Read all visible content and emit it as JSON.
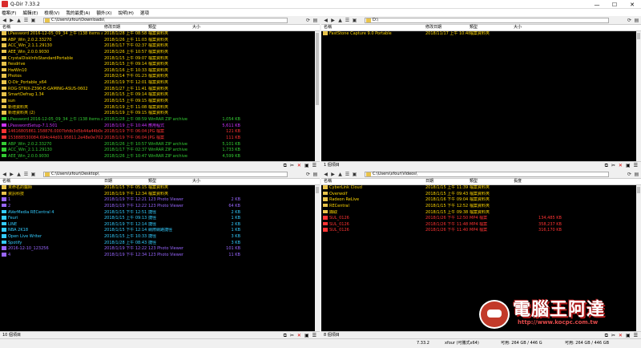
{
  "window": {
    "title": "Q-Dir 7.33.2",
    "min": "—",
    "max": "☐",
    "close": "✕"
  },
  "menu": [
    "檔案(F)",
    "編輯(E)",
    "檢視(V)",
    "我的最愛(A)",
    "額外(X)",
    "說明(H)",
    "選項"
  ],
  "colors": {
    "folder": "#ffd700",
    "exe": "#cc33ff",
    "zip": "#33cc33",
    "img": "#9966ff",
    "red": "#ff3333",
    "shortcut": "#33ccff"
  },
  "panes": [
    {
      "id": "tl",
      "path": "C:\\Users\\xfour\\Downloads\\",
      "status": "",
      "cols": [
        "名稱",
        "修改日期",
        "類型",
        "大小"
      ],
      "rows": [
        [
          "LPassword 2016-12-05_09_34 上午 (138 items and 1 fo...",
          "2018/1/28 上午 08:58",
          "檔案資料夾",
          "",
          "folder"
        ],
        [
          "ABP_Win_2.0.2.33270",
          "2018/1/26 上午 11:03",
          "檔案資料夾",
          "",
          "folder"
        ],
        [
          "ACC_Win_2.1.1.29130",
          "2018/1/17 下午 02:37",
          "檔案資料夾",
          "",
          "folder"
        ],
        [
          "AEE_Win_2.0.0.9030",
          "2018/1/26 上午 10:57",
          "檔案資料夾",
          "",
          "folder"
        ],
        [
          "CrystalDiskInfoStandardPortable",
          "2018/1/15 上午 09:07",
          "檔案資料夾",
          "",
          "folder"
        ],
        [
          "fiesdrive",
          "2018/1/15 上午 09:14",
          "檔案資料夾",
          "",
          "folder"
        ],
        [
          "HwWin10",
          "2018/1/16 上午 10:33",
          "檔案資料夾",
          "",
          "folder"
        ],
        [
          "Photos",
          "2018/2/14 下午 01:23",
          "檔案資料夾",
          "",
          "folder"
        ],
        [
          "Q-Dir_Portable_x64",
          "2018/1/19 下午 12:01",
          "檔案資料夾",
          "",
          "folder"
        ],
        [
          "ROG-STRIX-Z390-E-GAMING-ASUS-0602",
          "2018/1/27 上午 11:41",
          "檔案資料夾",
          "",
          "folder"
        ],
        [
          "SmartDefrag 1.34",
          "2018/1/15 上午 09:14",
          "檔案資料夾",
          "",
          "folder"
        ],
        [
          "sun",
          "2018/1/15 上午 09:15",
          "檔案資料夾",
          "",
          "folder"
        ],
        [
          "新增資料夾",
          "2018/1/19 上午 11:08",
          "檔案資料夾",
          "",
          "folder"
        ],
        [
          "新增資料夾 (2)",
          "2018/1/19 上午 09:15",
          "檔案資料夾",
          "",
          "folder"
        ],
        [
          "LPassword 2016-12-05_09_34 上午 (138 items and 1 fo...",
          "2018/1/28 上午 08:59",
          "WinRAR ZIP archive",
          "1,054 KB",
          "zip"
        ],
        [
          "LPasswordSetup-7.1.501",
          "2018/1/19 上午 10:44",
          "應用程式",
          "5,611 KB",
          "exe"
        ],
        [
          "14616805861.158876.0007bfdb3d5b44a44b0e3d47",
          "2018/1/19 下午 06:04",
          "JPG 檔案",
          "121 KB",
          "red"
        ],
        [
          "153888530084.694c44d01.95811.2e48e0e702fca39",
          "2018/1/19 下午 06:04",
          "JPG 檔案",
          "111 KB",
          "red"
        ],
        [
          "ABP_Win_2.0.2.33270",
          "2018/1/26 上午 10:57",
          "WinRAR ZIP archive",
          "5,101 KB",
          "zip"
        ],
        [
          "ACC_Win_2.1.1.29130",
          "2018/1/17 下午 02:37",
          "WinRAR ZIP archive",
          "1,733 KB",
          "zip"
        ],
        [
          "AEE_Win_2.0.0.9030",
          "2018/1/26 上午 10:47",
          "WinRAR ZIP archive",
          "4,599 KB",
          "zip"
        ]
      ]
    },
    {
      "id": "tr",
      "path": "D:\\",
      "status": "1 個項目",
      "cols": [
        "名稱",
        "修改日期",
        "類型",
        "大小"
      ],
      "rows": [
        [
          "FastStone Capture 9.0 Portable",
          "2018/11/17 上午 10:48",
          "檔案資料夾",
          "",
          "folder"
        ]
      ]
    },
    {
      "id": "bl",
      "path": "C:\\Users\\xfour\\Desktop\\",
      "status": "10 個項目",
      "cols": [
        "名稱",
        "日期",
        "類型",
        "大小"
      ],
      "rows": [
        [
          "未命名的醫師",
          "2018/1/15 下午 05:15",
          "檔案資料夾",
          "",
          "folder"
        ],
        [
          "資訊科技",
          "2018/1/19 下午 12:34",
          "檔案資料夾",
          "",
          "folder"
        ],
        [
          "1",
          "2018/1/19 下午 12:21",
          "123 Photo Viewer",
          "2 KB",
          "img"
        ],
        [
          "2",
          "2018/1/19 下午 12:22",
          "123 Photo Viewer",
          "64 KB",
          "img"
        ],
        [
          "AVerMedia RECentral 4",
          "2018/1/15 下午 12:51",
          "捷徑",
          "2 KB",
          "shortcut"
        ],
        [
          "Feuri",
          "2018/1/15 上午 09:13",
          "捷徑",
          "1 KB",
          "shortcut"
        ],
        [
          "LINE",
          "2018/1/19 下午 12:14",
          "捷徑",
          "2 KB",
          "shortcut"
        ],
        [
          "NBA 2K18",
          "2018/1/15 下午 12:14",
          "網際網路捷徑",
          "1 KB",
          "shortcut"
        ],
        [
          "Open Live Writer",
          "2018/1/15 上午 10:33",
          "捷徑",
          "3 KB",
          "shortcut"
        ],
        [
          "Spotify",
          "2018/1/28 上午 08:43",
          "捷徑",
          "3 KB",
          "shortcut"
        ],
        [
          "2016-12-10_123256",
          "2018/1/19 下午 12:22",
          "123 Photo Viewer",
          "101 KB",
          "img"
        ],
        [
          "4",
          "2018/1/19 下午 12:34",
          "123 Photo Viewer",
          "11 KB",
          "img"
        ]
      ]
    },
    {
      "id": "br",
      "path": "C:\\Users\\xfour\\Videos\\",
      "status": "8 個項目",
      "cols": [
        "名稱",
        "日期",
        "類型",
        "長度"
      ],
      "rows": [
        [
          "CyberLink Cloud",
          "2018/1/15 上午 11:39",
          "檔案資料夾",
          "",
          "folder"
        ],
        [
          "Overwolf",
          "2018/1/15 上午 09:43",
          "檔案資料夾",
          "",
          "folder"
        ],
        [
          "Radeon ReLive",
          "2018/1/16 下午 09:04",
          "檔案資料夾",
          "",
          "folder"
        ],
        [
          "RECentral",
          "2018/1/15 下午 12:52",
          "檔案資料夾",
          "",
          "folder"
        ],
        [
          "擷取",
          "2018/1/15 上午 09:38",
          "檔案資料夾",
          "",
          "folder"
        ],
        [
          "SUL_0126",
          "2018/1/26 下午 12:50",
          "MP4 檔案",
          "134,485 KB",
          "red"
        ],
        [
          "SUL_0126",
          "2018/1/26 下午 11:48",
          "MP4 檔案",
          "358,237 KB",
          "red"
        ],
        [
          "SUL_0126",
          "2018/1/26 下午 11:40",
          "MP4 檔案",
          "316,170 KB",
          "red"
        ]
      ]
    }
  ],
  "bottom": {
    "version": "7.33.2",
    "user": "xfour (可攜式x64)",
    "free": "可用: 264 GB / 446 G",
    "total": "可用: 264 GB / 446 GB"
  },
  "watermark": {
    "text": "電腦王阿達",
    "url": "http://www.kocpc.com.tw"
  }
}
